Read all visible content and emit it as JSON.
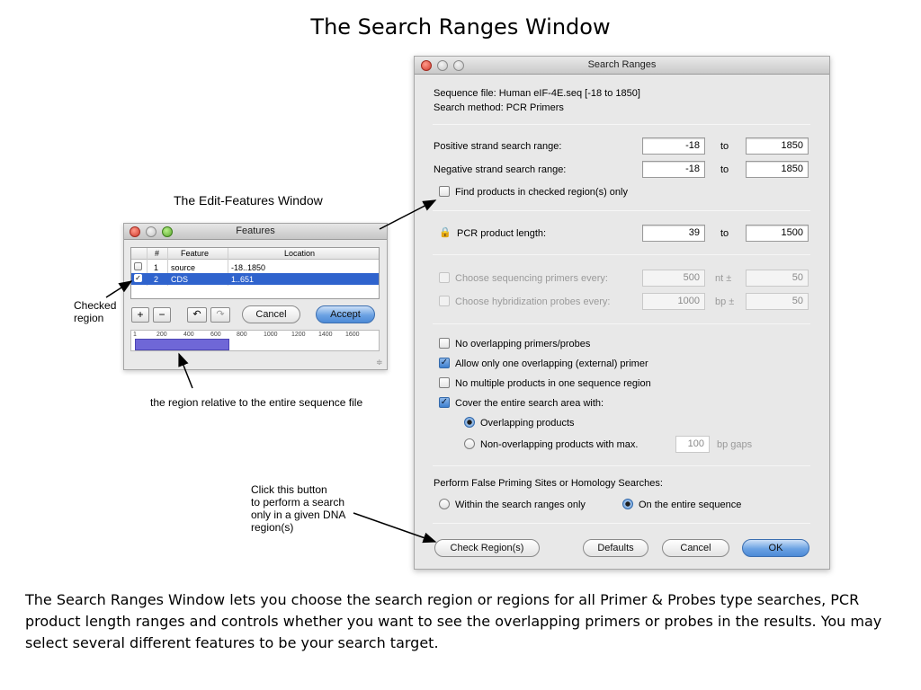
{
  "slide": {
    "title": "The Search Ranges Window",
    "caption": "The Search Ranges Window lets you choose the search region or regions for all Primer & Probes type searches, PCR product length ranges and controls whether you want to see the overlapping primers or probes in the results. You may select several different features to be your search target."
  },
  "search_window": {
    "title": "Search Ranges",
    "sequence_file": "Sequence file:  Human eIF-4E.seq  [-18 to 1850]",
    "search_method": "Search method:  PCR Primers",
    "positive_label": "Positive strand search range:",
    "positive_from": "-18",
    "positive_to": "1850",
    "negative_label": "Negative strand search range:",
    "negative_from": "-18",
    "negative_to": "1850",
    "to_label": "to",
    "find_checked_label": "Find products in checked region(s) only",
    "pcr_label": "PCR product length:",
    "pcr_from": "39",
    "pcr_to": "1500",
    "seq_primers_label": "Choose sequencing primers every:",
    "seq_primers_value": "500",
    "seq_primers_unit": "nt ±",
    "seq_primers_tol": "50",
    "hyb_probes_label": "Choose hybridization probes every:",
    "hyb_probes_value": "1000",
    "hyb_probes_unit": "bp ±",
    "hyb_probes_tol": "50",
    "opt_no_overlap": "No overlapping primers/probes",
    "opt_one_overlap": "Allow only one overlapping (external) primer",
    "opt_no_multiple": "No multiple products in one sequence region",
    "opt_cover": "Cover the entire search area with:",
    "radio_overlapping": "Overlapping products",
    "radio_nonoverlapping": "Non-overlapping products with max.",
    "gap_value": "100",
    "gap_unit": "bp gaps",
    "false_priming_label": "Perform False Priming Sites or Homology Searches:",
    "radio_within": "Within the search ranges only",
    "radio_entire": "On the entire sequence",
    "btn_check_region": "Check Region(s)",
    "btn_defaults": "Defaults",
    "btn_cancel": "Cancel",
    "btn_ok": "OK"
  },
  "features_window": {
    "heading": "The Edit-Features Window",
    "title": "Features",
    "col_num": "#",
    "col_feature": "Feature",
    "col_location": "Location",
    "rows": [
      {
        "num": "1",
        "feature": "source",
        "location": "-18..1850"
      },
      {
        "num": "2",
        "feature": "CDS",
        "location": "1..651"
      }
    ],
    "btn_cancel": "Cancel",
    "btn_accept": "Accept",
    "ruler_ticks": [
      "1",
      "200",
      "400",
      "600",
      "800",
      "1000",
      "1200",
      "1400",
      "1600"
    ]
  },
  "annotations": {
    "checked_region": "Checked\nregion",
    "region_relative": "the region relative to the entire sequence file",
    "click_button": "Click this button\nto perform a search\nonly in a given DNA\nregion(s)"
  }
}
